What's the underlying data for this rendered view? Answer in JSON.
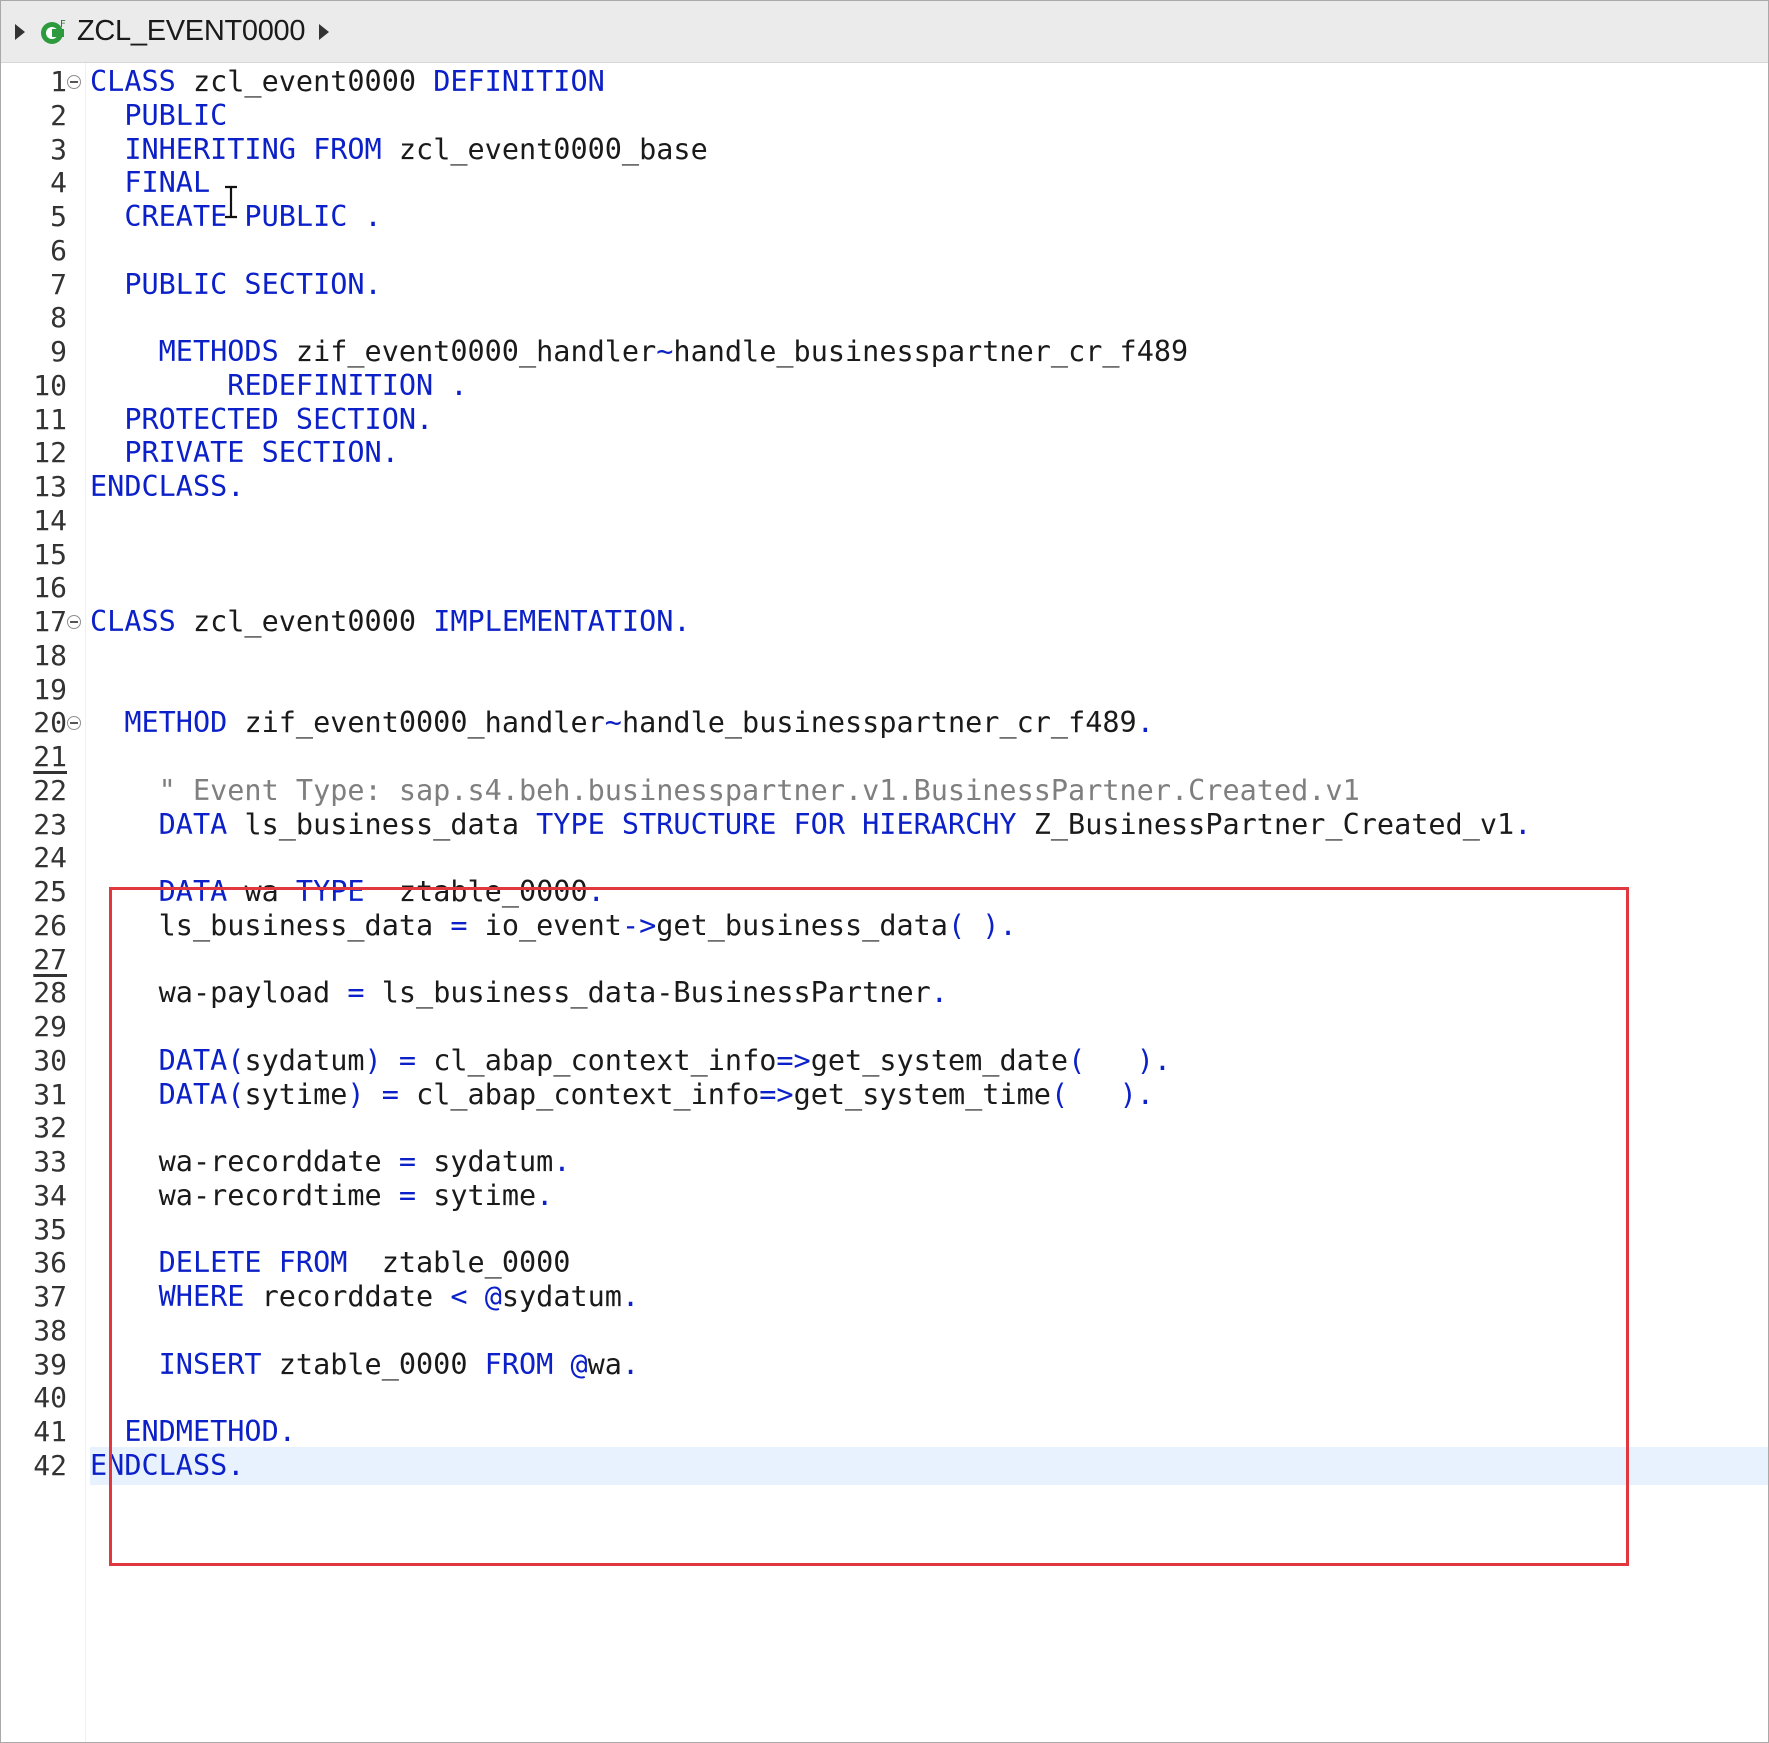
{
  "breadcrumb": {
    "class_name": "ZCL_EVENT0000"
  },
  "highlight_color": "#e0383e",
  "current_line": 42,
  "lines": [
    {
      "n": "1",
      "fold": true,
      "tokens": [
        [
          "k",
          "CLASS"
        ],
        [
          "t",
          " zcl_event0000 "
        ],
        [
          "k",
          "DEFINITION"
        ]
      ]
    },
    {
      "n": "2",
      "tokens": [
        [
          "t",
          "  "
        ],
        [
          "k",
          "PUBLIC"
        ]
      ]
    },
    {
      "n": "3",
      "tokens": [
        [
          "t",
          "  "
        ],
        [
          "k",
          "INHERITING FROM"
        ],
        [
          "t",
          " zcl_event0000_base"
        ]
      ]
    },
    {
      "n": "4",
      "tokens": [
        [
          "t",
          "  "
        ],
        [
          "k",
          "FINAL"
        ]
      ]
    },
    {
      "n": "5",
      "tokens": [
        [
          "t",
          "  "
        ],
        [
          "k",
          "CREATE PUBLIC ."
        ]
      ]
    },
    {
      "n": "6",
      "tokens": []
    },
    {
      "n": "7",
      "tokens": [
        [
          "t",
          "  "
        ],
        [
          "k",
          "PUBLIC SECTION."
        ]
      ]
    },
    {
      "n": "8",
      "tokens": []
    },
    {
      "n": "9",
      "tokens": [
        [
          "t",
          "    "
        ],
        [
          "k",
          "METHODS"
        ],
        [
          "t",
          " zif_event0000_handler"
        ],
        [
          "k",
          "~"
        ],
        [
          "t",
          "handle_businesspartner_cr_f489"
        ]
      ]
    },
    {
      "n": "10",
      "tokens": [
        [
          "t",
          "        "
        ],
        [
          "k",
          "REDEFINITION ."
        ]
      ]
    },
    {
      "n": "11",
      "tokens": [
        [
          "t",
          "  "
        ],
        [
          "k",
          "PROTECTED SECTION."
        ]
      ]
    },
    {
      "n": "12",
      "tokens": [
        [
          "t",
          "  "
        ],
        [
          "k",
          "PRIVATE SECTION."
        ]
      ]
    },
    {
      "n": "13",
      "tokens": [
        [
          "k",
          "ENDCLASS."
        ]
      ]
    },
    {
      "n": "14",
      "tokens": []
    },
    {
      "n": "15",
      "tokens": []
    },
    {
      "n": "16",
      "tokens": []
    },
    {
      "n": "17",
      "fold": true,
      "tokens": [
        [
          "k",
          "CLASS"
        ],
        [
          "t",
          " zcl_event0000 "
        ],
        [
          "k",
          "IMPLEMENTATION."
        ]
      ]
    },
    {
      "n": "18",
      "tokens": []
    },
    {
      "n": "19",
      "tokens": []
    },
    {
      "n": "20",
      "fold": true,
      "tokens": [
        [
          "t",
          "  "
        ],
        [
          "k",
          "METHOD"
        ],
        [
          "t",
          " zif_event0000_handler"
        ],
        [
          "k",
          "~"
        ],
        [
          "t",
          "handle_businesspartner_cr_f489"
        ],
        [
          "k",
          "."
        ]
      ]
    },
    {
      "n": "21",
      "underline": true,
      "tokens": []
    },
    {
      "n": "22",
      "tokens": [
        [
          "t",
          "    "
        ],
        [
          "c",
          "\" Event Type: sap.s4.beh.businesspartner.v1.BusinessPartner.Created.v1"
        ]
      ]
    },
    {
      "n": "23",
      "tokens": [
        [
          "t",
          "    "
        ],
        [
          "k",
          "DATA"
        ],
        [
          "t",
          " ls_business_data "
        ],
        [
          "k",
          "TYPE STRUCTURE FOR HIERARCHY"
        ],
        [
          "t",
          " Z_BusinessPartner_Created_v1"
        ],
        [
          "k",
          "."
        ]
      ]
    },
    {
      "n": "24",
      "tokens": []
    },
    {
      "n": "25",
      "tokens": [
        [
          "t",
          "    "
        ],
        [
          "k",
          "DATA"
        ],
        [
          "t",
          " wa "
        ],
        [
          "k",
          "TYPE"
        ],
        [
          "t",
          "  ztable_0000"
        ],
        [
          "k",
          "."
        ]
      ]
    },
    {
      "n": "26",
      "tokens": [
        [
          "t",
          "    ls_business_data "
        ],
        [
          "k",
          "="
        ],
        [
          "t",
          " io_event"
        ],
        [
          "k",
          "->"
        ],
        [
          "t",
          "get_business_data"
        ],
        [
          "k",
          "( )."
        ]
      ]
    },
    {
      "n": "27",
      "underline": true,
      "tokens": []
    },
    {
      "n": "28",
      "tokens": [
        [
          "t",
          "    wa-payload "
        ],
        [
          "k",
          "="
        ],
        [
          "t",
          " ls_business_data-BusinessPartner"
        ],
        [
          "k",
          "."
        ]
      ]
    },
    {
      "n": "29",
      "tokens": []
    },
    {
      "n": "30",
      "tokens": [
        [
          "t",
          "    "
        ],
        [
          "k",
          "DATA("
        ],
        [
          "t",
          "sydatum"
        ],
        [
          "k",
          ")"
        ],
        [
          "t",
          " "
        ],
        [
          "k",
          "="
        ],
        [
          "t",
          " cl_abap_context_info"
        ],
        [
          "k",
          "=>"
        ],
        [
          "t",
          "get_system_date"
        ],
        [
          "k",
          "(   )."
        ]
      ]
    },
    {
      "n": "31",
      "tokens": [
        [
          "t",
          "    "
        ],
        [
          "k",
          "DATA("
        ],
        [
          "t",
          "sytime"
        ],
        [
          "k",
          ")"
        ],
        [
          "t",
          " "
        ],
        [
          "k",
          "="
        ],
        [
          "t",
          " cl_abap_context_info"
        ],
        [
          "k",
          "=>"
        ],
        [
          "t",
          "get_system_time"
        ],
        [
          "k",
          "(   )."
        ]
      ]
    },
    {
      "n": "32",
      "tokens": []
    },
    {
      "n": "33",
      "tokens": [
        [
          "t",
          "    wa-recorddate "
        ],
        [
          "k",
          "="
        ],
        [
          "t",
          " sydatum"
        ],
        [
          "k",
          "."
        ]
      ]
    },
    {
      "n": "34",
      "tokens": [
        [
          "t",
          "    wa-recordtime "
        ],
        [
          "k",
          "="
        ],
        [
          "t",
          " sytime"
        ],
        [
          "k",
          "."
        ]
      ]
    },
    {
      "n": "35",
      "tokens": []
    },
    {
      "n": "36",
      "tokens": [
        [
          "t",
          "    "
        ],
        [
          "k",
          "DELETE FROM"
        ],
        [
          "t",
          "  ztable_0000"
        ]
      ]
    },
    {
      "n": "37",
      "tokens": [
        [
          "t",
          "    "
        ],
        [
          "k",
          "WHERE"
        ],
        [
          "t",
          " recorddate "
        ],
        [
          "k",
          "<"
        ],
        [
          "t",
          " "
        ],
        [
          "k",
          "@"
        ],
        [
          "t",
          "sydatum"
        ],
        [
          "k",
          "."
        ]
      ]
    },
    {
      "n": "38",
      "tokens": []
    },
    {
      "n": "39",
      "tokens": [
        [
          "t",
          "    "
        ],
        [
          "k",
          "INSERT"
        ],
        [
          "t",
          " ztable_0000 "
        ],
        [
          "k",
          "FROM"
        ],
        [
          "t",
          " "
        ],
        [
          "k",
          "@"
        ],
        [
          "t",
          "wa"
        ],
        [
          "k",
          "."
        ]
      ]
    },
    {
      "n": "40",
      "tokens": []
    },
    {
      "n": "41",
      "tokens": [
        [
          "t",
          "  "
        ],
        [
          "k",
          "ENDMETHOD."
        ]
      ]
    },
    {
      "n": "42",
      "tokens": [
        [
          "k",
          "ENDCLASS."
        ]
      ]
    }
  ]
}
